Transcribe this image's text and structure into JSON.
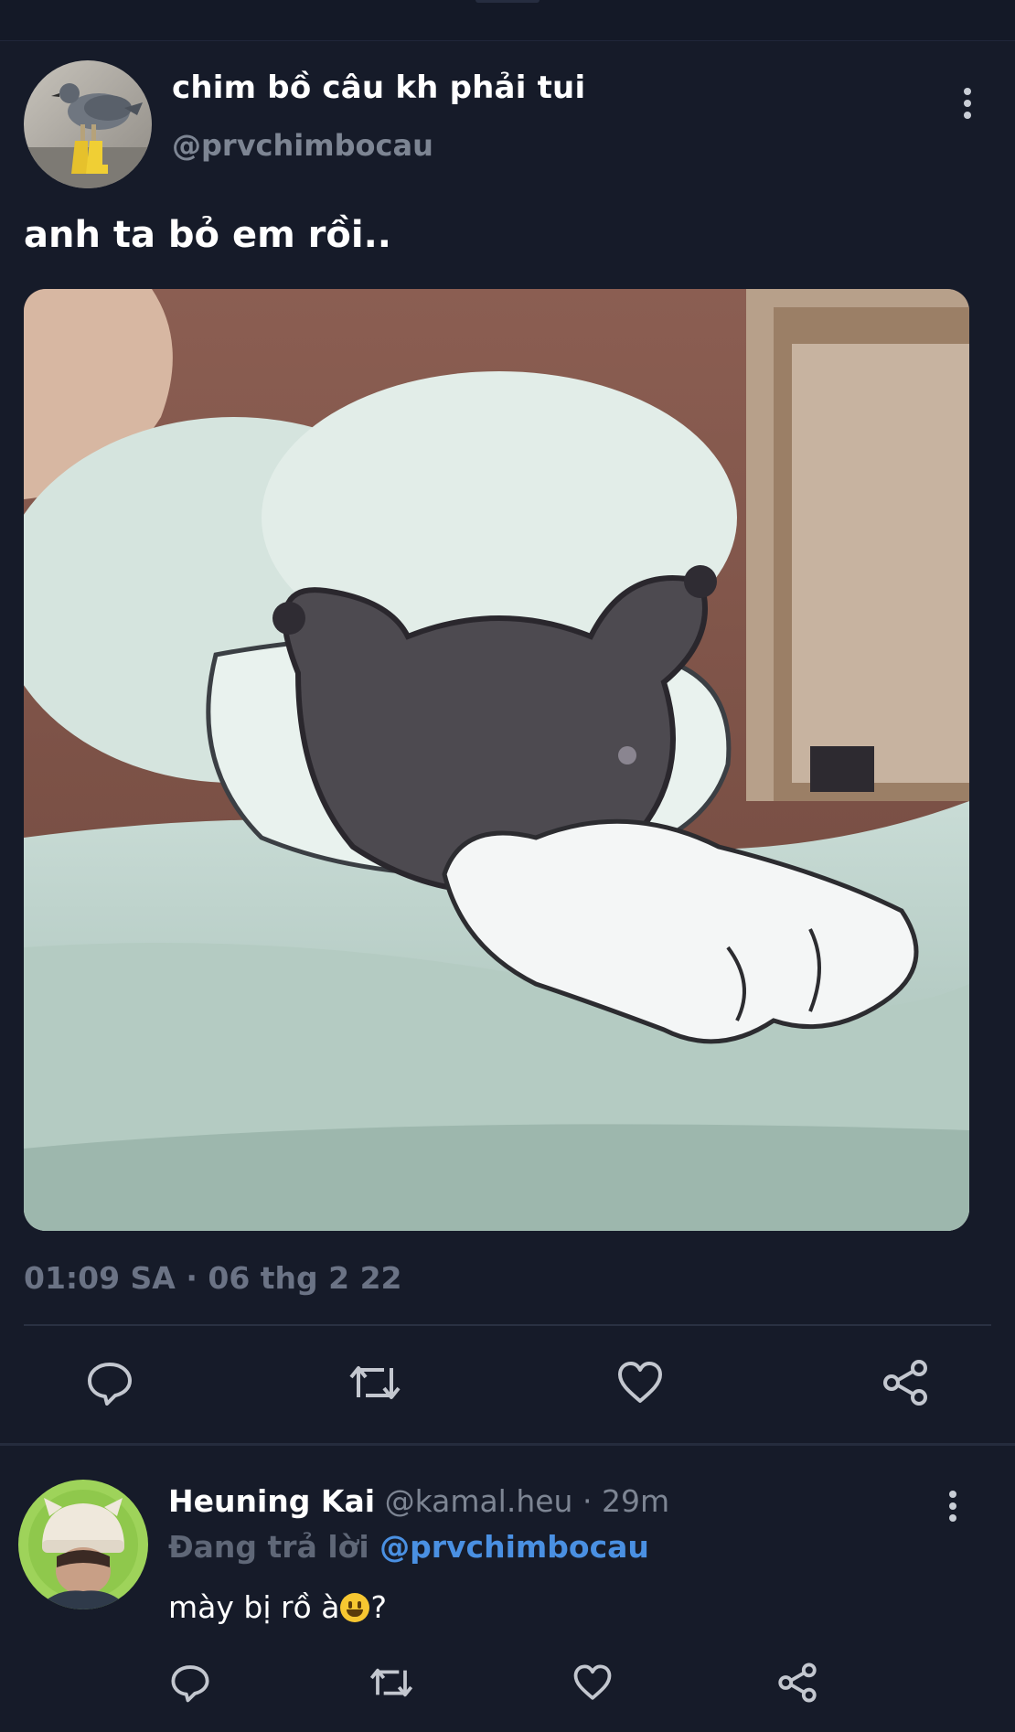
{
  "tweet": {
    "display_name": "chim bồ câu kh phải tui",
    "handle": "@prvchimbocau",
    "text": "anh ta bỏ em rồi..",
    "timestamp": "01:09 SA · 06 thg 2 22",
    "avatar_icon": "pigeon-in-boots"
  },
  "actions": [
    "reply-icon",
    "retweet-icon",
    "like-icon",
    "share-icon"
  ],
  "reply": {
    "display_name": "Heuning Kai",
    "handle": "@kamal.heu",
    "time": "29m",
    "replying_label": "Đang trả lời",
    "replying_to": "@prvchimbocau",
    "text_before": "mày bị rồ à",
    "emoji": "😃",
    "text_after": "?"
  },
  "colors": {
    "background": "#161b29",
    "muted_text": "#7d8593",
    "mention": "#4a90e2",
    "divider": "#2a3142"
  }
}
